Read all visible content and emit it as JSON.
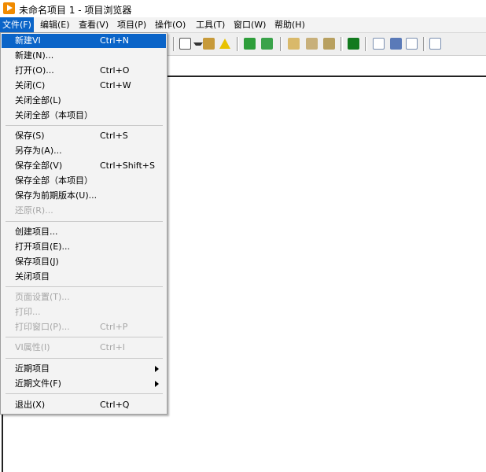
{
  "window": {
    "title": "未命名项目 1 - 项目浏览器"
  },
  "menubar": [
    "文件(F)",
    "编辑(E)",
    "查看(V)",
    "项目(P)",
    "操作(O)",
    "工具(T)",
    "窗口(W)",
    "帮助(H)"
  ],
  "file_menu": {
    "groups": [
      [
        {
          "label": "新建VI",
          "shortcut": "Ctrl+N",
          "selected": true
        },
        {
          "label": "新建(N)...",
          "shortcut": ""
        },
        {
          "label": "打开(O)...",
          "shortcut": "Ctrl+O"
        },
        {
          "label": "关闭(C)",
          "shortcut": "Ctrl+W"
        },
        {
          "label": "关闭全部(L)",
          "shortcut": ""
        },
        {
          "label": "关闭全部（本项目）",
          "shortcut": ""
        }
      ],
      [
        {
          "label": "保存(S)",
          "shortcut": "Ctrl+S"
        },
        {
          "label": "另存为(A)...",
          "shortcut": ""
        },
        {
          "label": "保存全部(V)",
          "shortcut": "Ctrl+Shift+S"
        },
        {
          "label": "保存全部（本项目）",
          "shortcut": ""
        },
        {
          "label": "保存为前期版本(U)...",
          "shortcut": ""
        },
        {
          "label": "还原(R)...",
          "shortcut": "",
          "disabled": true
        }
      ],
      [
        {
          "label": "创建项目...",
          "shortcut": ""
        },
        {
          "label": "打开项目(E)...",
          "shortcut": ""
        },
        {
          "label": "保存项目(J)",
          "shortcut": ""
        },
        {
          "label": "关闭项目",
          "shortcut": ""
        }
      ],
      [
        {
          "label": "页面设置(T)...",
          "shortcut": "",
          "disabled": true
        },
        {
          "label": "打印...",
          "shortcut": "",
          "disabled": true
        },
        {
          "label": "打印窗口(P)...",
          "shortcut": "Ctrl+P",
          "disabled": true
        }
      ],
      [
        {
          "label": "VI属性(I)",
          "shortcut": "Ctrl+I",
          "disabled": true
        }
      ],
      [
        {
          "label": "近期项目",
          "shortcut": "",
          "submenu": true
        },
        {
          "label": "近期文件(F)",
          "shortcut": "",
          "submenu": true
        }
      ],
      [
        {
          "label": "退出(X)",
          "shortcut": "Ctrl+Q"
        }
      ]
    ]
  },
  "colors": {
    "highlight": "#0a64c8",
    "disabled_text": "#a6a6a6",
    "app_icon": "#f08a00"
  },
  "toolbar_icons": [
    "window-grid-icon",
    "dropdown-arrow-icon",
    "build-icon",
    "warning-icon",
    "add-green-icon",
    "add-item-icon",
    "deploy-icon",
    "build-spec-icon",
    "refresh-icon",
    "panel-icon",
    "undo-doc-icon",
    "undo-icon",
    "redo-doc-icon",
    "find-icon"
  ]
}
